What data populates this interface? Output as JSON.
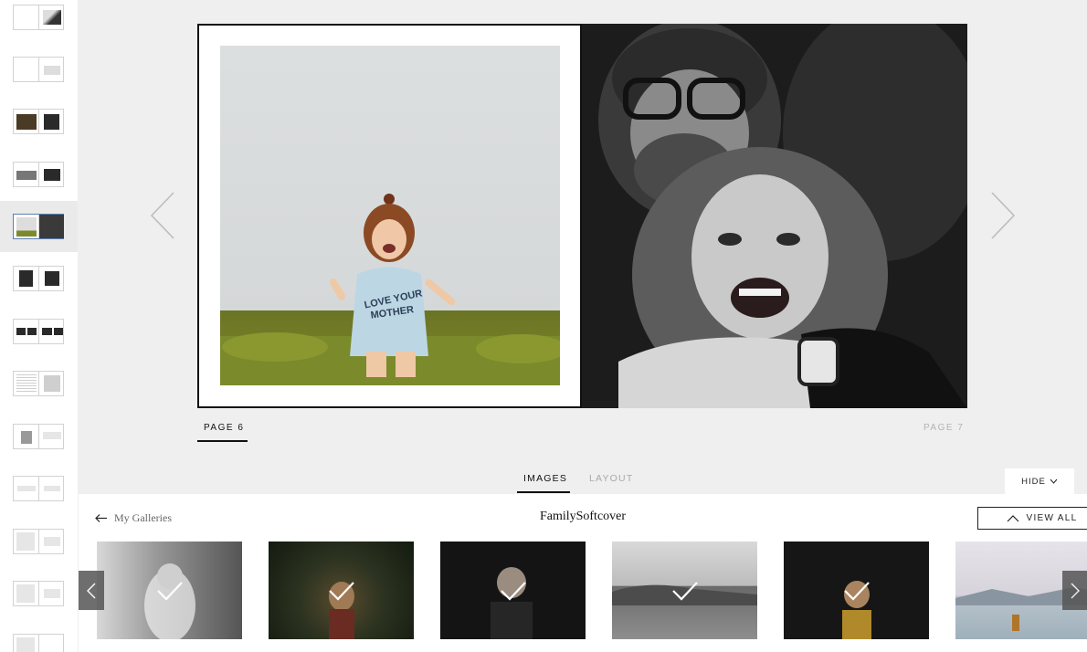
{
  "spread": {
    "left_page_label": "PAGE 6",
    "right_page_label": "PAGE 7"
  },
  "tabs": [
    {
      "label": "IMAGES",
      "active": true
    },
    {
      "label": "LAYOUT",
      "active": false
    }
  ],
  "hide_button": {
    "label": "HIDE",
    "icon": "chevron-down-icon"
  },
  "gallery": {
    "back_label": "My Galleries",
    "title": "FamilySoftcover",
    "view_all_label": "VIEW ALL",
    "thumbnails": [
      {
        "tone": "bw-light",
        "selected": true
      },
      {
        "tone": "forest",
        "selected": true
      },
      {
        "tone": "dark",
        "selected": true
      },
      {
        "tone": "beach",
        "selected": true
      },
      {
        "tone": "dark-warm",
        "selected": true
      },
      {
        "tone": "lake",
        "selected": false
      }
    ]
  },
  "sidebar": {
    "active_index": 4,
    "spread_count": 13
  },
  "colors": {
    "background": "#efefef",
    "active_thumb_border": "#5b7fb3",
    "text_dark": "#111111",
    "text_muted": "#a9a9a9"
  }
}
